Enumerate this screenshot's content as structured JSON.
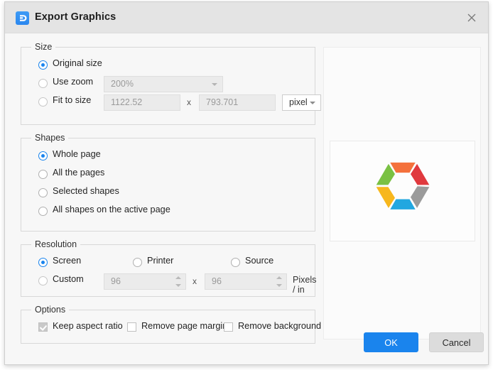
{
  "window": {
    "title": "Export Graphics",
    "app_icon": "edraw-logo-icon",
    "close_icon": "close-icon"
  },
  "size_group": {
    "legend": "Size",
    "options": [
      {
        "label": "Original size",
        "selected": true
      },
      {
        "label": "Use zoom",
        "selected": false
      },
      {
        "label": "Fit to size",
        "selected": false
      }
    ],
    "zoom_value": "200%",
    "fit_width": "1122.52",
    "fit_height": "793.701",
    "multiply_symbol": "x",
    "unit_value": "pixel"
  },
  "shapes_group": {
    "legend": "Shapes",
    "options": [
      {
        "label": "Whole page",
        "selected": true
      },
      {
        "label": "All the pages",
        "selected": false
      },
      {
        "label": "Selected shapes",
        "selected": false
      },
      {
        "label": "All shapes on the active page",
        "selected": false
      }
    ]
  },
  "resolution_group": {
    "legend": "Resolution",
    "options": [
      {
        "label": "Screen",
        "selected": true
      },
      {
        "label": "Printer",
        "selected": false
      },
      {
        "label": "Source",
        "selected": false
      },
      {
        "label": "Custom",
        "selected": false
      }
    ],
    "custom_x": "96",
    "custom_y": "96",
    "multiply_symbol": "x",
    "unit_label": "Pixels / in"
  },
  "options_group": {
    "legend": "Options",
    "checkboxes": [
      {
        "label": "Keep aspect ratio",
        "checked": true,
        "disabled": true
      },
      {
        "label": "Remove page margin",
        "checked": false,
        "disabled": false
      },
      {
        "label": "Remove background",
        "checked": false,
        "disabled": false
      }
    ]
  },
  "preview": {
    "name": "export-preview",
    "diagram": "hexagon-cycle-diagram",
    "segment_colors": [
      "#f4713c",
      "#e0393e",
      "#9b9b9b",
      "#21a7e0",
      "#f7b71d",
      "#7ac143"
    ]
  },
  "footer": {
    "ok_label": "OK",
    "cancel_label": "Cancel",
    "accent_color": "#1a84ed"
  }
}
